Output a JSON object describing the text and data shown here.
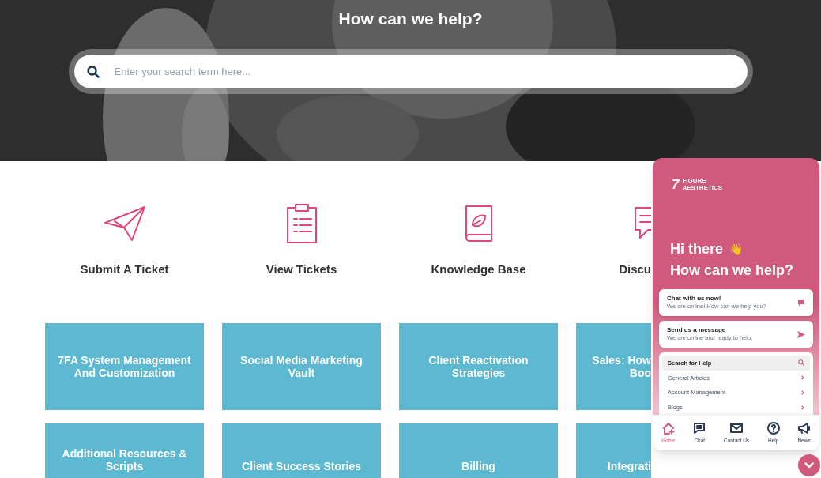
{
  "hero": {
    "title": "How can we help?",
    "search": {
      "placeholder": "Enter your search term here..."
    }
  },
  "actions": [
    {
      "kind": "plane",
      "label": "Submit A Ticket"
    },
    {
      "kind": "clipboard",
      "label": "View Tickets"
    },
    {
      "kind": "book",
      "label": "Knowledge Base"
    },
    {
      "kind": "chat",
      "label": "Discu"
    }
  ],
  "categories": [
    {
      "lines": [
        "7FA System Management",
        "And Customization"
      ],
      "cut": false
    },
    {
      "lines": [
        "Social Media Marketing",
        "Vault"
      ],
      "cut": false
    },
    {
      "lines": [
        "Client Reactivation",
        "Strategies"
      ],
      "cut": false
    },
    {
      "lines": [
        "Sales: How",
        "Boo"
      ],
      "cut": true
    },
    {
      "lines": [
        "Additional Resources &",
        "Scripts"
      ],
      "cut": false
    },
    {
      "lines": [
        "Client Success Stories"
      ],
      "cut": false
    },
    {
      "lines": [
        "Billing"
      ],
      "cut": false
    },
    {
      "lines": [
        "Integrati"
      ],
      "cut": true
    }
  ],
  "widget": {
    "logo_number": "7",
    "logo_lines": [
      "FIGURE",
      "AESTHETICS"
    ],
    "greeting": "Hi there",
    "wave": "👋",
    "heading": "How can we help?",
    "cards": [
      {
        "kind": "chat",
        "title": "Chat with us now!",
        "subtitle": "We are online! How can we help you?"
      },
      {
        "kind": "send",
        "title": "Send us a message",
        "subtitle": "We are online and ready to help."
      }
    ],
    "help_search": "Search for Help",
    "links": [
      "General Articles",
      "Account Management",
      "Blogs"
    ],
    "nav": [
      {
        "kind": "home",
        "label": "Home",
        "selected": true
      },
      {
        "kind": "chat",
        "label": "Chat",
        "selected": false
      },
      {
        "kind": "mail",
        "label": "Contact Us",
        "selected": false
      },
      {
        "kind": "help",
        "label": "Help",
        "selected": false
      },
      {
        "kind": "news",
        "label": "News",
        "selected": false
      }
    ]
  }
}
